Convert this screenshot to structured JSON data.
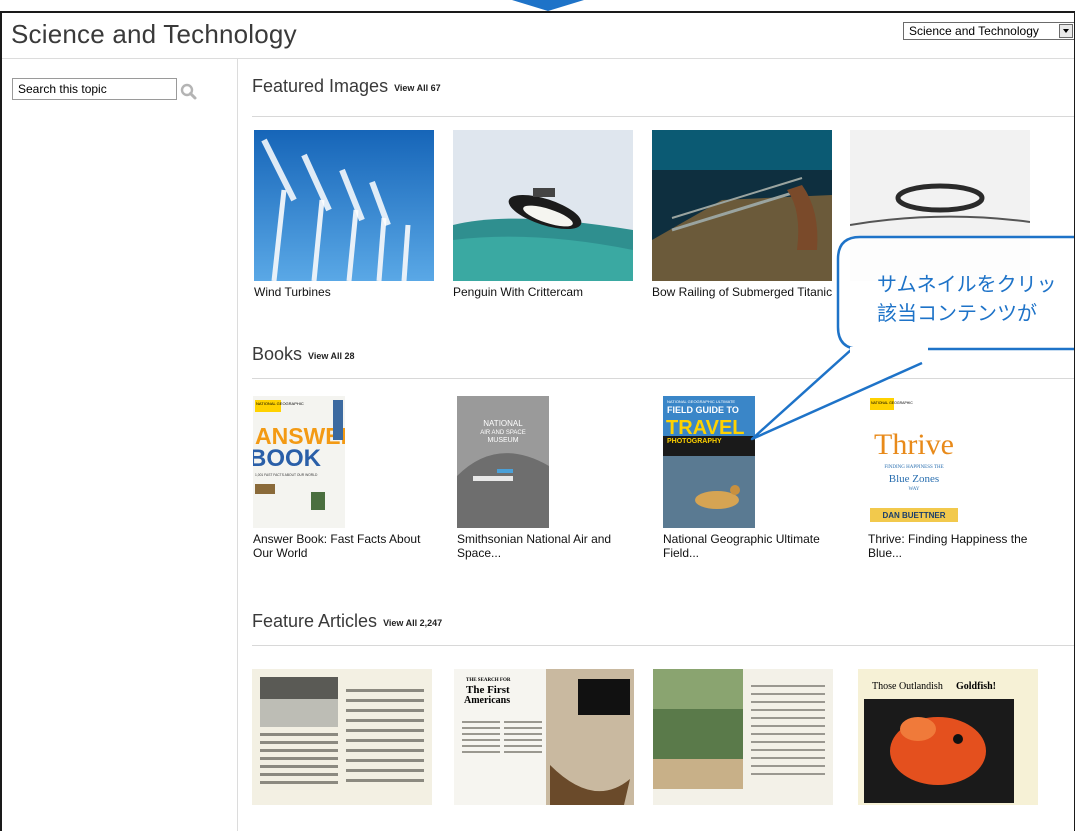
{
  "header": {
    "title": "Science and Technology",
    "topic_select_value": "Science and Technology"
  },
  "search": {
    "placeholder": "Search this topic",
    "value": "Search this topic"
  },
  "sections": {
    "featured_images": {
      "title": "Featured Images",
      "view_all": "View All 67",
      "items": [
        {
          "caption": "Wind Turbines"
        },
        {
          "caption": "Penguin With Crittercam"
        },
        {
          "caption": "Bow Railing of Submerged Titanic"
        },
        {
          "caption": ""
        }
      ]
    },
    "books": {
      "title": "Books",
      "view_all": "View All 28",
      "items": [
        {
          "caption": "Answer Book: Fast Facts About Our World",
          "cover_text": [
            "NATIONAL GEOGRAPHIC",
            "ANSWER",
            "BOOK",
            "1,001 FAST FACTS ABOUT OUR WORLD"
          ]
        },
        {
          "caption": "Smithsonian National Air and Space...",
          "cover_text": [
            "NATIONAL",
            "AIR AND SPACE",
            "MUSEUM"
          ]
        },
        {
          "caption": "National Geographic Ultimate Field...",
          "cover_text": [
            "NATIONAL GEOGRAPHIC ULTIMATE",
            "FIELD GUIDE TO",
            "TRAVEL",
            "PHOTOGRAPHY"
          ]
        },
        {
          "caption": "Thrive: Finding Happiness the Blue...",
          "cover_text": [
            "NATIONAL GEOGRAPHIC",
            "Thrive",
            "FINDING HAPPINESS THE",
            "Blue Zones",
            "WAY",
            "DAN BUETTNER"
          ]
        }
      ]
    },
    "feature_articles": {
      "title": "Feature Articles",
      "view_all": "View All 2,247",
      "items": [
        {
          "caption": "",
          "page_text": []
        },
        {
          "caption": "",
          "page_text": [
            "THE SEARCH FOR",
            "The First",
            "Americans"
          ]
        },
        {
          "caption": "",
          "page_text": []
        },
        {
          "caption": "",
          "page_text": [
            "Those Outlandish",
            "Goldfish!"
          ]
        }
      ]
    }
  },
  "callout": {
    "line1": "サムネイルをクリッ",
    "line2": "該当コンテンツが"
  },
  "colors": {
    "callout_blue": "#1e73c8",
    "title_gray": "#3a3a3a"
  },
  "icons": {
    "search": "search-icon",
    "dropdown": "chevron-down-icon"
  }
}
